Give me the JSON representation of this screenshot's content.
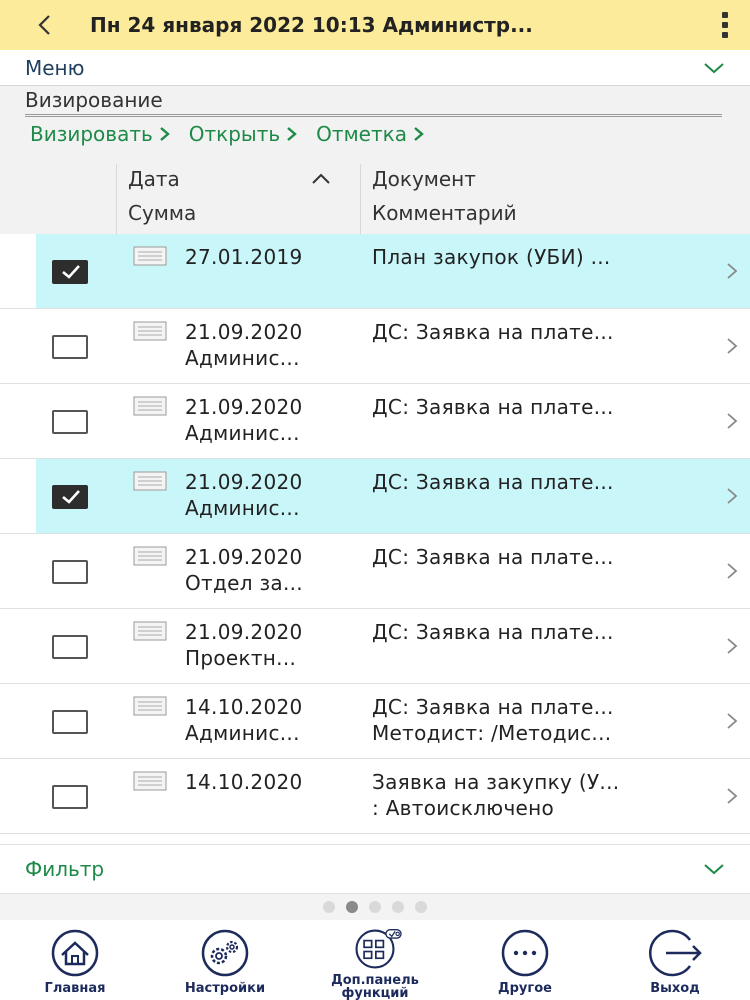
{
  "header": {
    "title": "Пн 24 января 2022 10:13 Администр..."
  },
  "menu": {
    "label": "Меню"
  },
  "section": {
    "title": "Визирование",
    "actions": [
      {
        "label": "Визировать"
      },
      {
        "label": "Открыть"
      },
      {
        "label": "Отметка"
      }
    ]
  },
  "columns": {
    "date": "Дата",
    "sum": "Сумма",
    "document": "Документ",
    "comment": "Комментарий"
  },
  "rows": [
    {
      "checked": true,
      "date": "27.01.2019",
      "sum": "",
      "document": "План закупок (УБИ) ...",
      "comment": ""
    },
    {
      "checked": false,
      "date": "21.09.2020",
      "sum": "Админис...",
      "document": "ДС: Заявка на плате...",
      "comment": ""
    },
    {
      "checked": false,
      "date": "21.09.2020",
      "sum": "Админис...",
      "document": "ДС: Заявка на плате...",
      "comment": ""
    },
    {
      "checked": true,
      "date": "21.09.2020",
      "sum": "Админис...",
      "document": "ДС: Заявка на плате...",
      "comment": ""
    },
    {
      "checked": false,
      "date": "21.09.2020",
      "sum": "Отдел за...",
      "document": "ДС: Заявка на плате...",
      "comment": ""
    },
    {
      "checked": false,
      "date": "21.09.2020",
      "sum": "Проектн...",
      "document": "ДС: Заявка на плате...",
      "comment": ""
    },
    {
      "checked": false,
      "date": "14.10.2020",
      "sum": "Админис...",
      "document": "ДС: Заявка на плате...",
      "comment": "Методист: /Методис..."
    },
    {
      "checked": false,
      "date": "14.10.2020",
      "sum": "",
      "document": "Заявка на закупку (У...",
      "comment": ": Автоисключено"
    }
  ],
  "filter": {
    "label": "Фильтр"
  },
  "pager": {
    "count": 5,
    "active_index": 1
  },
  "nav": [
    {
      "label": "Главная",
      "icon": "home-icon"
    },
    {
      "label": "Настройки",
      "icon": "gears-icon"
    },
    {
      "label": "Доп.панель функций",
      "icon": "function-panel-icon"
    },
    {
      "label": "Другое",
      "icon": "more-icon"
    },
    {
      "label": "Выход",
      "icon": "exit-icon"
    }
  ],
  "colors": {
    "header_bg": "#fbeb9a",
    "accent_green": "#1e8a47",
    "selected_row": "#c9f6f8",
    "nav_dark": "#1d2b5c"
  }
}
